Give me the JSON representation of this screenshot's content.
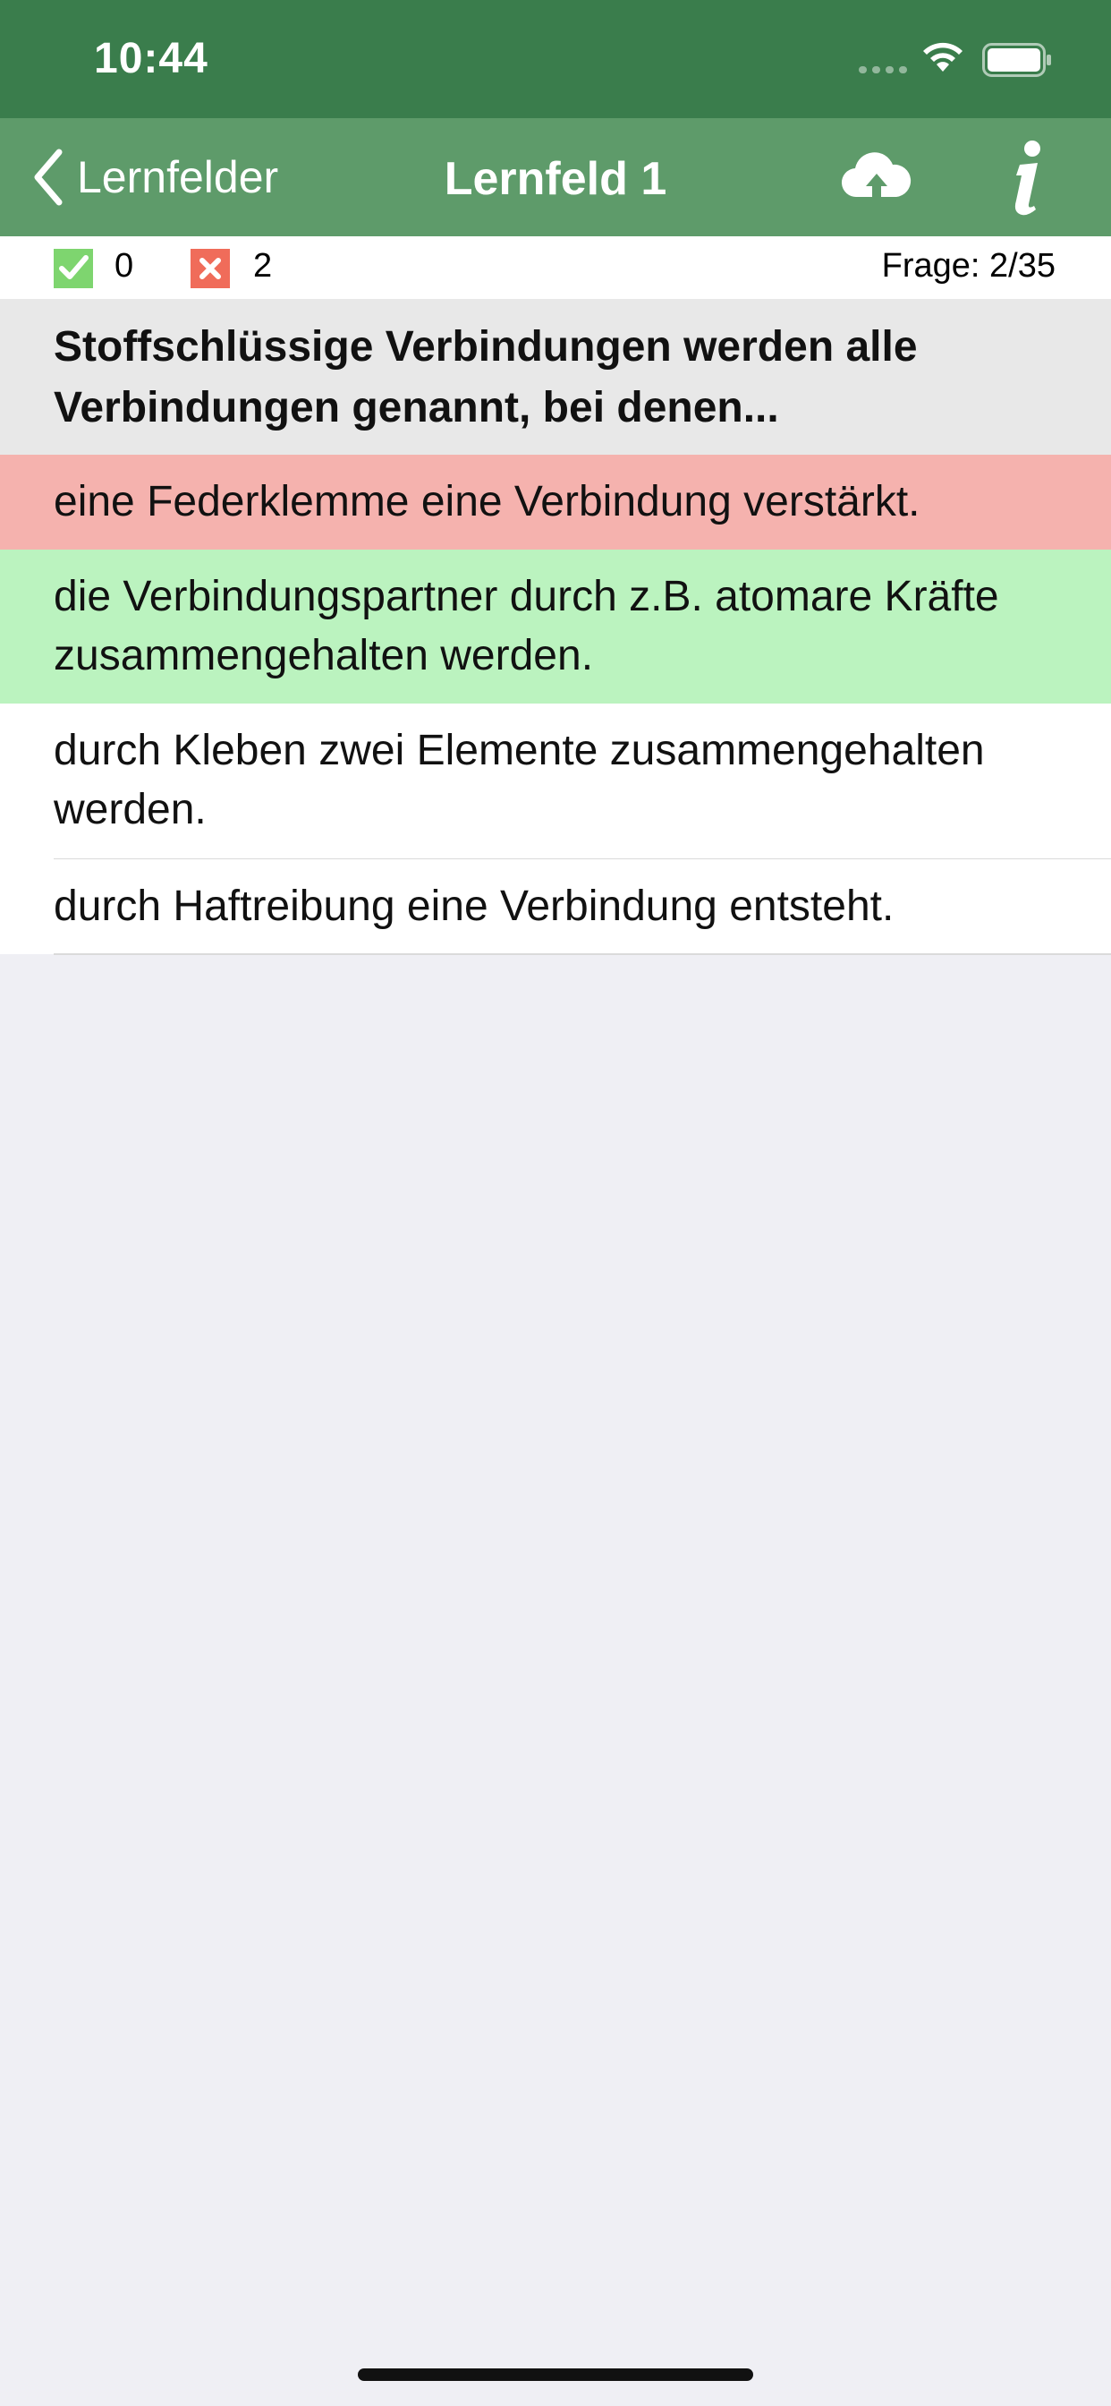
{
  "status_bar": {
    "time": "10:44"
  },
  "nav": {
    "back_label": "Lernfelder",
    "title": "Lernfeld 1",
    "upload_icon": "cloud-upload-icon",
    "info_icon": "info-icon"
  },
  "score": {
    "correct": "0",
    "wrong": "2",
    "counter": "Frage: 2/35",
    "correct_color": "#7ed56f",
    "wrong_color": "#f06c5a"
  },
  "question": {
    "text": "Stoffschlüssige Verbindungen werden alle Verbindungen genannt, bei denen..."
  },
  "answers": [
    {
      "text": "eine Federklemme eine Verbindung verstärkt.",
      "state": "wrong",
      "color": "#f5b2ae"
    },
    {
      "text": "die Verbindungspartner durch z.B. atomare Kräfte zusammengehalten werden.",
      "state": "correct",
      "color": "#bbf3bf"
    },
    {
      "text": "durch Kleben zwei Elemente zusammengehalten werden.",
      "state": "neutral",
      "color": "#ffffff"
    },
    {
      "text": "durch Haftreibung eine Verbindung entsteht.",
      "state": "neutral",
      "color": "#ffffff"
    }
  ],
  "colors": {
    "status_bar": "#3a7d4c",
    "nav_bar": "#5e9b6a",
    "background": "#efeff4"
  }
}
